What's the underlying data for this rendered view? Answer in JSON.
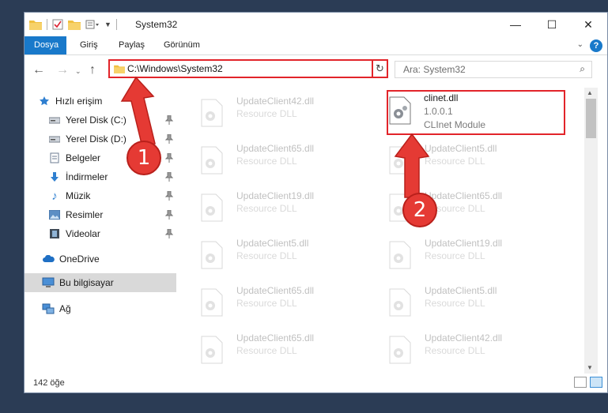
{
  "window": {
    "title": "System32",
    "buttons": {
      "minimize": "—",
      "maximize": "☐",
      "close": "✕"
    }
  },
  "ribbon": {
    "tabs": [
      {
        "label": "Dosya",
        "active": true
      },
      {
        "label": "Giriş"
      },
      {
        "label": "Paylaş"
      },
      {
        "label": "Görünüm"
      }
    ],
    "help": "?"
  },
  "nav": {
    "address": "C:\\Windows\\System32",
    "search_placeholder": "Ara: System32"
  },
  "sidebar": {
    "items": [
      {
        "label": "Hızlı erişim",
        "icon": "star-icon",
        "pinned": false
      },
      {
        "label": "Yerel Disk (C:)",
        "icon": "drive-icon",
        "pinned": true
      },
      {
        "label": "Yerel Disk (D:)",
        "icon": "drive-icon",
        "pinned": true
      },
      {
        "label": "Belgeler",
        "icon": "documents-icon",
        "pinned": true
      },
      {
        "label": "İndirmeler",
        "icon": "download-icon",
        "pinned": true
      },
      {
        "label": "Müzik",
        "icon": "music-icon",
        "pinned": true
      },
      {
        "label": "Resimler",
        "icon": "pictures-icon",
        "pinned": true
      },
      {
        "label": "Videolar",
        "icon": "videos-icon",
        "pinned": true
      },
      {
        "label": "OneDrive",
        "icon": "cloud-icon",
        "pinned": false
      },
      {
        "label": "Bu bilgisayar",
        "icon": "computer-icon",
        "pinned": false,
        "selected": true
      },
      {
        "label": "Ağ",
        "icon": "network-icon",
        "pinned": false
      }
    ]
  },
  "files": {
    "left": [
      {
        "name": "UpdateClient42.dll",
        "type": "Resource DLL"
      },
      {
        "name": "UpdateClient65.dll",
        "type": "Resource DLL"
      },
      {
        "name": "UpdateClient19.dll",
        "type": "Resource DLL"
      },
      {
        "name": "UpdateClient5.dll",
        "type": "Resource DLL"
      },
      {
        "name": "UpdateClient65.dll",
        "type": "Resource DLL"
      },
      {
        "name": "UpdateClient65.dll",
        "type": "Resource DLL"
      }
    ],
    "highlighted": {
      "name": "clinet.dll",
      "version": "1.0.0.1",
      "description": "CLInet Module"
    },
    "right": [
      {
        "name": "UpdateClient5.dll",
        "type": "Resource DLL"
      },
      {
        "name": "UpdateClient65.dll",
        "type": "Resource DLL"
      },
      {
        "name": "UpdateClient19.dll",
        "type": "Resource DLL"
      },
      {
        "name": "UpdateClient5.dll",
        "type": "Resource DLL"
      },
      {
        "name": "UpdateClient42.dll",
        "type": "Resource DLL"
      }
    ]
  },
  "status": {
    "item_count": "142 öğe"
  },
  "callouts": [
    "1",
    "2"
  ],
  "colors": {
    "accent": "#1979ca",
    "highlight": "#e2242a",
    "arrow": "#e53a34"
  }
}
